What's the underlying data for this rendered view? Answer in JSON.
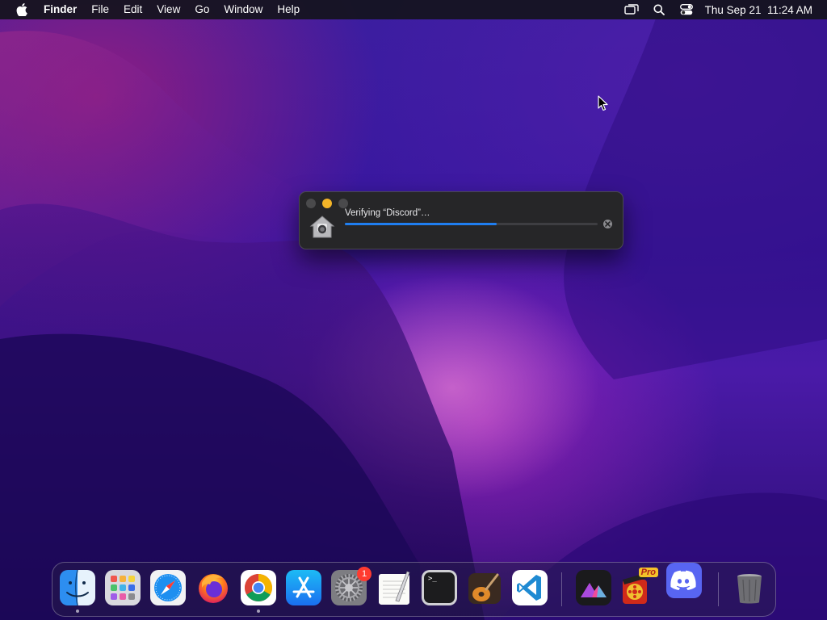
{
  "menubar": {
    "app_name": "Finder",
    "menus": [
      "File",
      "Edit",
      "View",
      "Go",
      "Window",
      "Help"
    ],
    "right_icons": [
      "screen-mirroring-icon",
      "spotlight-search-icon",
      "control-center-icon"
    ],
    "clock": "Thu Sep 21  11:24 AM"
  },
  "dialog": {
    "message": "Verifying “Discord”…",
    "progress": 0.6,
    "progress_color": "#1f7ef0",
    "icon": "gatekeeper-house-icon"
  },
  "dock": {
    "apps": [
      {
        "name": "Finder",
        "icon": "finder-icon",
        "running": true
      },
      {
        "name": "Launchpad",
        "icon": "launchpad-icon",
        "running": false
      },
      {
        "name": "Safari",
        "icon": "safari-icon",
        "running": false
      },
      {
        "name": "Firefox",
        "icon": "firefox-icon",
        "running": false
      },
      {
        "name": "Google Chrome",
        "icon": "chrome-icon",
        "running": true
      },
      {
        "name": "App Store",
        "icon": "app-store-icon",
        "running": false
      },
      {
        "name": "System Preferences",
        "icon": "system-preferences-icon",
        "running": false,
        "badge": "1"
      },
      {
        "name": "TextEdit",
        "icon": "textedit-icon",
        "running": false
      },
      {
        "name": "Terminal",
        "icon": "terminal-icon",
        "running": false
      },
      {
        "name": "GarageBand",
        "icon": "garageband-icon",
        "running": false
      },
      {
        "name": "Visual Studio Code",
        "icon": "vscode-icon",
        "running": false
      },
      {
        "name": "Darkroom",
        "icon": "darkroom-icon",
        "running": false
      },
      {
        "name": "Movie Maker Pro",
        "icon": "movie-maker-pro-icon",
        "running": false
      },
      {
        "name": "Discord",
        "icon": "discord-icon",
        "running": false
      },
      {
        "name": "Trash",
        "icon": "trash-icon",
        "running": false
      }
    ],
    "badge_text": "1",
    "pro_label": "Pro",
    "terminal_prompt": ">_"
  }
}
